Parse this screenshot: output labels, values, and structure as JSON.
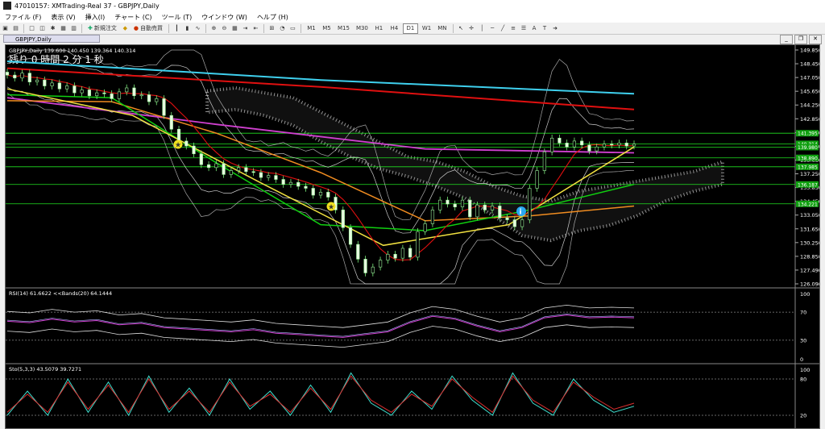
{
  "window": {
    "title": "47010157: XMTrading-Real 37 - GBPJPY,Daily"
  },
  "menu": [
    "ファイル (F)",
    "表示 (V)",
    "挿入(I)",
    "チャート (C)",
    "ツール (T)",
    "ウインドウ (W)",
    "ヘルプ (H)"
  ],
  "toolbar": {
    "new_order_label": "新規注文",
    "auto_trade_label": "自動売買",
    "timeframes": [
      "M1",
      "M5",
      "M15",
      "M30",
      "H1",
      "H4",
      "D1",
      "W1",
      "MN"
    ],
    "active_timeframe": "D1"
  },
  "chart_tab": {
    "label": "GBPJPY,Daily"
  },
  "main_chart": {
    "info": "GBPJPY,Daily  139.600 140.450 139.364 140.314",
    "countdown": "残り 0 時間 2 分 1 秒",
    "price_ticks": [
      "149.850",
      "148.450",
      "147.050",
      "145.650",
      "144.250",
      "142.850",
      "141.450",
      "140.050",
      "138.650",
      "137.250",
      "135.850",
      "134.450",
      "133.050",
      "131.650",
      "130.250",
      "128.850",
      "127.490",
      "126.090"
    ],
    "level_labels": [
      "141.395",
      "140.314",
      "139.980",
      "138.890",
      "137.985",
      "136.187",
      "134.221"
    ]
  },
  "rsi_panel": {
    "info": "RSI(14) 61.6622  <<Bands(20) 64.1444",
    "ticks": [
      "100",
      "70",
      "30",
      "0"
    ]
  },
  "stoch_panel": {
    "info": "Sto(5,3,3) 43.5079 39.7271",
    "ticks": [
      "100",
      "80",
      "20"
    ]
  },
  "colors": {
    "ma_cyan": "#3fd0ee",
    "ma_red": "#e01010",
    "ma_magenta": "#d040d0",
    "ma_orange": "#f08c20",
    "ma_yellow": "#f0e040",
    "ma_green": "#10d010",
    "bb": "#e0e0e0",
    "level": "#20e020"
  },
  "chart_data": {
    "type": "line",
    "ylim": [
      126.09,
      149.85
    ],
    "series": [
      {
        "key": "close",
        "values": [
          147.3,
          147.0,
          147.5,
          146.6,
          146.8,
          146.2,
          146.5,
          145.9,
          146.2,
          145.5,
          145.8,
          145.2,
          145.5,
          145.4,
          144.9,
          145.6,
          146.0,
          145.2,
          145.3,
          144.6,
          144.9,
          143.2,
          141.8,
          140.6,
          140.1,
          139.3,
          138.2,
          137.9,
          138.3,
          137.2,
          137.6,
          137.9,
          137.5,
          137.4,
          136.9,
          137.1,
          136.7,
          136.2,
          136.4,
          136.0,
          135.8,
          135.1,
          135.4,
          134.9,
          133.6,
          131.8,
          130.1,
          128.6,
          127.2,
          127.8,
          128.5,
          129.1,
          128.7,
          129.7,
          128.8,
          131.4,
          132.2,
          133.6,
          134.6,
          134.2,
          133.9,
          134.6,
          132.9,
          134.1,
          133.6,
          134.0,
          132.8,
          132.6,
          131.9,
          132.6,
          135.8,
          137.6,
          139.5,
          140.9,
          140.4,
          140.0,
          140.6,
          140.2,
          139.6,
          140.0,
          140.3,
          140.2,
          140.4,
          140.1,
          140.3
        ]
      },
      {
        "key": "ma_cyan_long",
        "values": [
          148.7,
          146.8,
          145.4
        ]
      },
      {
        "key": "ma_red_long",
        "values": [
          148.0,
          146.1,
          143.8
        ]
      },
      {
        "key": "ma_magenta",
        "values": [
          145.0,
          142.3,
          139.8,
          139.4
        ]
      },
      {
        "key": "ma_orange",
        "values": [
          144.7,
          144.6,
          141.4,
          137.4,
          132.5,
          133.0,
          134.0
        ]
      },
      {
        "key": "ma_green",
        "values": [
          145.3,
          145.0,
          138.4,
          132.1,
          131.5,
          133.6,
          136.2
        ]
      },
      {
        "key": "ma_yellow",
        "values": [
          145.9,
          143.2,
          136.5,
          130.0,
          132.1,
          140.0
        ]
      },
      {
        "key": "rsi",
        "values": [
          57,
          55,
          60,
          56,
          58,
          52,
          54,
          48,
          46,
          44,
          42,
          45,
          40,
          38,
          36,
          34,
          38,
          42,
          55,
          64,
          60,
          50,
          42,
          48,
          62,
          66,
          62,
          63,
          62
        ]
      },
      {
        "key": "stoch_main",
        "values": [
          20,
          60,
          20,
          80,
          25,
          75,
          20,
          85,
          25,
          65,
          20,
          80,
          30,
          60,
          20,
          70,
          25,
          90,
          40,
          20,
          60,
          30,
          85,
          45,
          20,
          90,
          40,
          20,
          80,
          45,
          25,
          35
        ]
      },
      {
        "key": "stoch_signal",
        "values": [
          25,
          55,
          25,
          75,
          30,
          70,
          25,
          80,
          30,
          60,
          25,
          75,
          35,
          55,
          25,
          65,
          30,
          85,
          45,
          25,
          55,
          35,
          80,
          50,
          25,
          85,
          45,
          25,
          75,
          50,
          30,
          40
        ]
      }
    ]
  }
}
